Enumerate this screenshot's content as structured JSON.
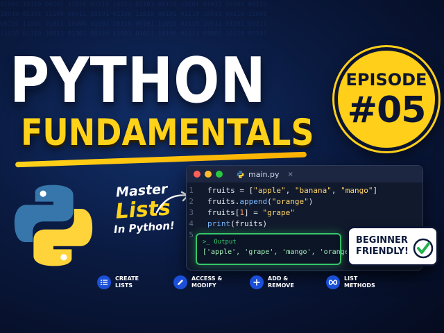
{
  "title": {
    "line1": "PYTHON",
    "line2": "FUNDAMENTALS"
  },
  "episode": {
    "label": "EPISODE",
    "number": "#05"
  },
  "tagline": {
    "line1": "Master",
    "line2": "Lists",
    "line3": "In Python!"
  },
  "editor": {
    "filename": "main.py",
    "close_glyph": "×",
    "line_numbers": [
      "1",
      "2",
      "3",
      "4",
      "5"
    ]
  },
  "output": {
    "header": ">_ Output",
    "value": "['apple', 'grape', 'mango', 'orange']"
  },
  "badge": {
    "line1": "BEGINNER",
    "line2": "FRIENDLY!"
  },
  "features": [
    {
      "label": "CREATE\nLISTS",
      "icon": "list-icon"
    },
    {
      "label": "ACCESS &\nMODIFY",
      "icon": "pencil-icon"
    },
    {
      "label": "ADD &\nREMOVE",
      "icon": "plus-icon"
    },
    {
      "label": "LIST\nMETHODS",
      "icon": "infinity-icon"
    }
  ],
  "colors": {
    "accent_yellow": "#ffd21a",
    "background": "#0a1a40",
    "output_green": "#35c86a",
    "feature_blue": "#1b4fd8"
  }
}
